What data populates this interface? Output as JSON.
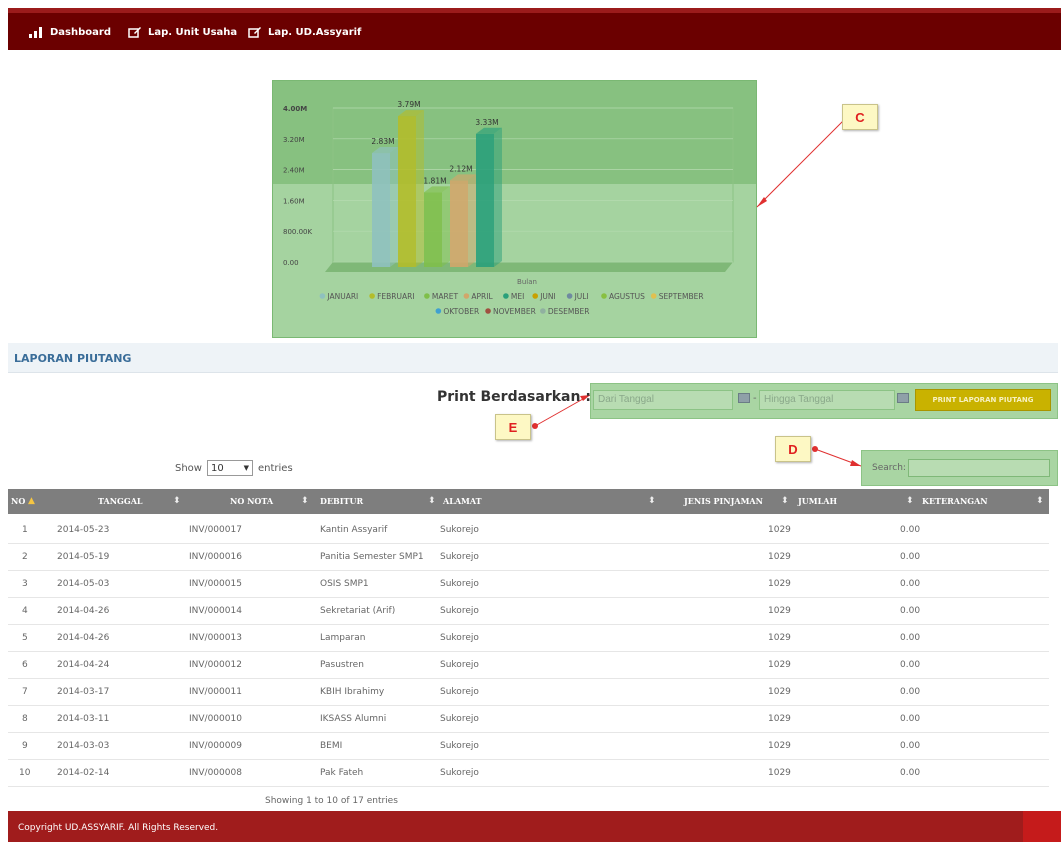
{
  "nav": [
    {
      "label": "Dashboard",
      "icon": "bar-chart-icon"
    },
    {
      "label": "Lap. Unit Usaha",
      "icon": "edit-icon"
    },
    {
      "label": "Lap. UD.Assyarif",
      "icon": "edit-icon"
    }
  ],
  "chart_data": {
    "type": "bar",
    "categories": [
      "JANUARI",
      "FEBRUARI",
      "MARET",
      "APRIL",
      "MEI",
      "JUNI",
      "JULI",
      "AGUSTUS",
      "SEPTEMBER",
      "OKTOBER",
      "NOVEMBER",
      "DESEMBER"
    ],
    "values": [
      2.83,
      3.79,
      1.81,
      2.12,
      3.33,
      0,
      0,
      0,
      0,
      0,
      0,
      0
    ],
    "data_labels": [
      "2.83M",
      "3.79M",
      "1.81M",
      "2.12M",
      "3.33M"
    ],
    "xlabel": "Bulan",
    "yticks": [
      "0.00",
      "800.00K",
      "1.60M",
      "2.40M",
      "3.20M",
      "4.00M"
    ],
    "ylim": [
      0,
      4
    ],
    "legend_position": "bottom",
    "colors": [
      "#8fc1bf",
      "#b3bd2a",
      "#7fbf4a",
      "#d2a66a",
      "#2aa07a",
      "#c8a000",
      "#6f8aa0",
      "#88c040",
      "#e0c050",
      "#40a0d0",
      "#a05040",
      "#90b0a0"
    ]
  },
  "callouts": {
    "c": "C",
    "d": "D",
    "e": "E"
  },
  "section": {
    "title": "LAPORAN PIUTANG"
  },
  "print": {
    "label": "Print Berdasarkan :",
    "from_placeholder": "Dari Tanggal",
    "to_placeholder": "Hingga Tanggal",
    "separator": "-",
    "button": "PRINT LAPORAN PIUTANG"
  },
  "search": {
    "label": "Search:"
  },
  "length": {
    "prefix": "Show",
    "value": "10",
    "suffix": "entries"
  },
  "table": {
    "headers": [
      "NO",
      "TANGGAL",
      "NO NOTA",
      "DEBITUR",
      "ALAMAT",
      "JENIS PINJAMAN",
      "JUMLAH",
      "KETERANGAN"
    ],
    "rows": [
      [
        "1",
        "2014-05-23",
        "INV/000017",
        "Kantin Assyarif",
        "Sukorejo",
        "1029",
        "0.00"
      ],
      [
        "2",
        "2014-05-19",
        "INV/000016",
        "Panitia Semester SMP1",
        "Sukorejo",
        "1029",
        "0.00"
      ],
      [
        "3",
        "2014-05-03",
        "INV/000015",
        "OSIS SMP1",
        "Sukorejo",
        "1029",
        "0.00"
      ],
      [
        "4",
        "2014-04-26",
        "INV/000014",
        "Sekretariat (Arif)",
        "Sukorejo",
        "1029",
        "0.00"
      ],
      [
        "5",
        "2014-04-26",
        "INV/000013",
        "Lamparan",
        "Sukorejo",
        "1029",
        "0.00"
      ],
      [
        "6",
        "2014-04-24",
        "INV/000012",
        "Pasustren",
        "Sukorejo",
        "1029",
        "0.00"
      ],
      [
        "7",
        "2014-03-17",
        "INV/000011",
        "KBIH Ibrahimy",
        "Sukorejo",
        "1029",
        "0.00"
      ],
      [
        "8",
        "2014-03-11",
        "INV/000010",
        "IKSASS Alumni",
        "Sukorejo",
        "1029",
        "0.00"
      ],
      [
        "9",
        "2014-03-03",
        "INV/000009",
        "BEMI",
        "Sukorejo",
        "1029",
        "0.00"
      ],
      [
        "10",
        "2014-02-14",
        "INV/000008",
        "Pak Fateh",
        "Sukorejo",
        "1029",
        "0.00"
      ]
    ]
  },
  "info": "Showing 1 to 10 of 17 entries",
  "footer": "Copyright UD.ASSYARIF. All Rights Reserved."
}
